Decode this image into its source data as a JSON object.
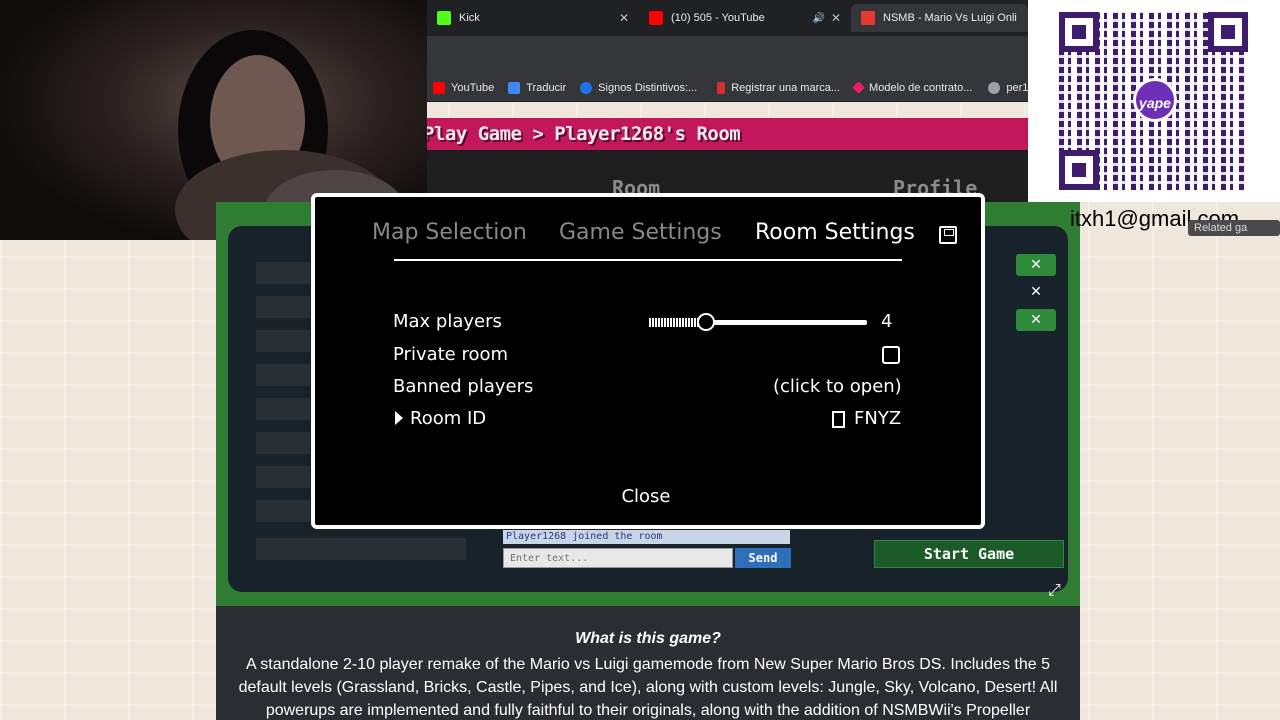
{
  "browser": {
    "tabs": [
      {
        "label": "Kick",
        "icon": "kick-icon",
        "icon_color": "#53fc18"
      },
      {
        "label": "(10) 505 - YouTube",
        "icon": "youtube-icon",
        "icon_color": "#ff0000"
      },
      {
        "label": "NSMB - Mario Vs Luigi Onli",
        "icon": "game-icon",
        "icon_color": "#e53935"
      }
    ],
    "bookmarks": [
      {
        "label": "YouTube",
        "icon": "youtube-icon",
        "icon_color": "#ff0000"
      },
      {
        "label": "Traducir",
        "icon": "translate-icon",
        "icon_color": "#4285f4"
      },
      {
        "label": "Signos Distintivos:...",
        "icon": "circle-icon",
        "icon_color": "#1a73e8"
      },
      {
        "label": "Registrar una marca...",
        "icon": "flag-icon",
        "icon_color": "#d32f2f"
      },
      {
        "label": "Modelo de contrato...",
        "icon": "diamond-icon",
        "icon_color": "#e91e63"
      },
      {
        "label": "per1",
        "icon": "globe-icon",
        "icon_color": "#9aa0a6"
      }
    ]
  },
  "page": {
    "breadcrumb": "Play Game > Player1268's Room",
    "nav_tabs": [
      "Room",
      "Profile"
    ]
  },
  "modal": {
    "tabs": [
      "Map Selection",
      "Game Settings",
      "Room Settings"
    ],
    "active_tab": "Room Settings",
    "rows": {
      "max_players_label": "Max players",
      "max_players_value": "4",
      "max_players_fraction": 0.26,
      "private_room_label": "Private room",
      "private_room_checked": false,
      "banned_players_label": "Banned players",
      "banned_players_value": "(click to open)",
      "room_id_label": "Room ID",
      "room_id_value": "FNYZ"
    },
    "close_label": "Close"
  },
  "lobby": {
    "chat_message": "Player1268 joined the room",
    "chat_placeholder": "Enter text...",
    "send_label": "Send",
    "start_label": "Start Game",
    "kick_icon": "x-icon",
    "accent_green": "#2e7d32"
  },
  "description": {
    "title": "What is this game?",
    "body": "A standalone 2-10 player remake of the Mario vs Luigi gamemode from New Super Mario Bros DS. Includes the 5 default levels (Grassland, Bricks, Castle, Pipes, and Ice), along with custom levels: Jungle, Sky, Volcano, Desert! All powerups are implemented and fully faithful to their originals, along with the addition of NSMBWii's Propeller"
  },
  "overlay": {
    "qr_brand": "yape",
    "email_fragment": "itxh1@gmail.com",
    "related_label": "Related ga"
  }
}
